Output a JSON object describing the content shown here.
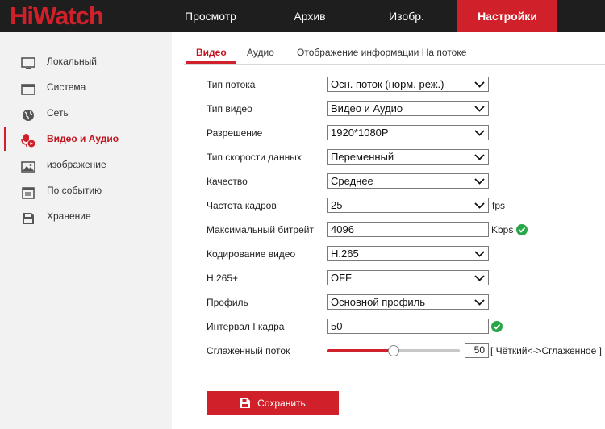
{
  "brand": {
    "logo_text": "HiWatch",
    "accent": "#d0202a"
  },
  "topnav": [
    {
      "label": "Просмотр"
    },
    {
      "label": "Архив"
    },
    {
      "label": "Изобр."
    },
    {
      "label": "Настройки",
      "active": true
    }
  ],
  "sidebar": {
    "items": [
      {
        "label": "Локальный",
        "icon": "monitor-icon"
      },
      {
        "label": "Система",
        "icon": "window-icon"
      },
      {
        "label": "Сеть",
        "icon": "globe-icon"
      },
      {
        "label": "Видео и Аудио",
        "icon": "mic-camera-icon",
        "active": true
      },
      {
        "label": "изображение",
        "icon": "image-icon"
      },
      {
        "label": "По событию",
        "icon": "calendar-icon"
      },
      {
        "label": "Хранение",
        "icon": "floppy-icon"
      }
    ]
  },
  "tabs": [
    {
      "label": "Видео",
      "active": true
    },
    {
      "label": "Аудио"
    },
    {
      "label": "Отображение информации На потоке"
    }
  ],
  "form": {
    "stream_type": {
      "label": "Тип потока",
      "value": "Осн. поток (норм. реж.)"
    },
    "video_type": {
      "label": "Тип видео",
      "value": "Видео и Аудио"
    },
    "resolution": {
      "label": "Разрешение",
      "value": "1920*1080P"
    },
    "bitrate_type": {
      "label": "Тип скорости данных",
      "value": "Переменный"
    },
    "quality": {
      "label": "Качество",
      "value": "Среднее"
    },
    "frame_rate": {
      "label": "Частота кадров",
      "value": "25",
      "unit": "fps"
    },
    "max_bitrate": {
      "label": "Максимальный битрейт",
      "value": "4096",
      "unit": "Kbps"
    },
    "encoding": {
      "label": "Кодирование видео",
      "value": "H.265"
    },
    "h265plus": {
      "label": "H.265+",
      "value": "OFF"
    },
    "profile": {
      "label": "Профиль",
      "value": "Основной профиль"
    },
    "i_frame": {
      "label": "Интервал I кадра",
      "value": "50"
    },
    "smoothing": {
      "label": "Сглаженный поток",
      "value": "50",
      "fraction": 0.5,
      "hint": "[ Чёткий<->Сглаженное ]"
    }
  },
  "save_label": "Сохранить"
}
